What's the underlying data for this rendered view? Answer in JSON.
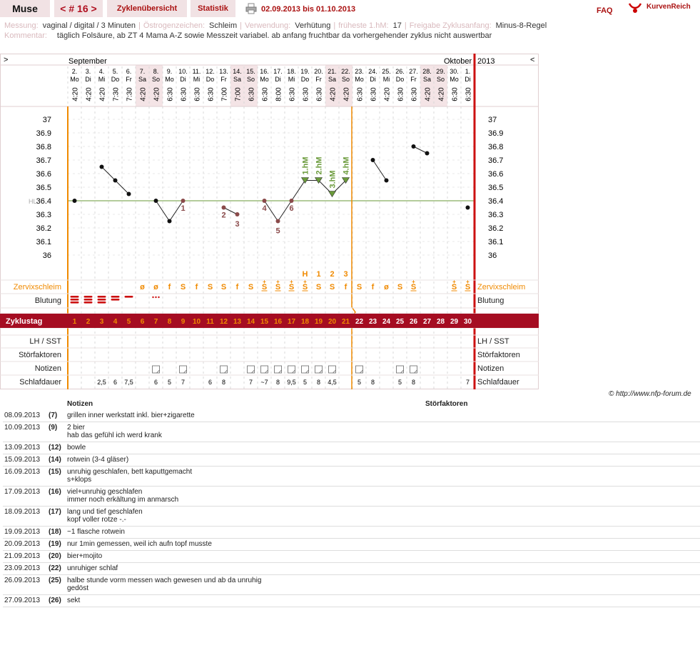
{
  "header": {
    "name": "Muse",
    "cycle_nav": "< # 16 >",
    "tab_overview": "Zyklenübersicht",
    "tab_stats": "Statistik",
    "date_range": "02.09.2013 bis 01.10.2013",
    "faq": "FAQ",
    "logo": "KurvenReich"
  },
  "info": {
    "measure_label": "Messung:",
    "measure": "vaginal / digital / 3 Minuten",
    "estrogen_label": "Östrogenzeichen:",
    "estrogen": "Schleim",
    "usage_label": "Verwendung:",
    "usage": "Verhütung",
    "earliest_label": "früheste 1.hM:",
    "earliest": "17",
    "release_label": "Freigabe Zyklusanfang:",
    "release": "Minus-8-Regel",
    "comment_label": "Kommentar:",
    "comment": "täglich Folsäure, ab ZT 4 Mama A-Z sowie Messzeit variabel. ab anfang fruchtbar da vorhergehender zyklus nicht auswertbar"
  },
  "months": {
    "left_arrow": ">",
    "sep": "September",
    "oct": "Oktober",
    "year": "2013",
    "right_arrow": "<"
  },
  "day_nums": [
    "2.",
    "3.",
    "4.",
    "5.",
    "6.",
    "7.",
    "8.",
    "9.",
    "10.",
    "11.",
    "12.",
    "13.",
    "14.",
    "15.",
    "16.",
    "17.",
    "18.",
    "19.",
    "20.",
    "21.",
    "22.",
    "23.",
    "24.",
    "25.",
    "26.",
    "27.",
    "28.",
    "29.",
    "30.",
    "1."
  ],
  "weekdays": [
    "Mo",
    "Di",
    "Mi",
    "Do",
    "Fr",
    "Sa",
    "So",
    "Mo",
    "Di",
    "Mi",
    "Do",
    "Fr",
    "Sa",
    "So",
    "Mo",
    "Di",
    "Mi",
    "Do",
    "Fr",
    "Sa",
    "So",
    "Mo",
    "Di",
    "Mi",
    "Do",
    "Fr",
    "Sa",
    "So",
    "Mo",
    "Di"
  ],
  "times": [
    "4:20",
    "4:20",
    "4:20",
    "7:30",
    "7:30",
    "4:20",
    "4:20",
    "6:30",
    "6:30",
    "6:30",
    "6:30",
    "7:00",
    "7:00",
    "6:30",
    "6:30",
    "8:00",
    "6:30",
    "6:30",
    "6:30",
    "4:20",
    "4:20",
    "6:30",
    "6:30",
    "4:20",
    "6:30",
    "6:30",
    "4:20",
    "4:20",
    "6:30",
    "6:30"
  ],
  "weekend": [
    5,
    6,
    12,
    13,
    19,
    20,
    26,
    27
  ],
  "chart_data": {
    "type": "line",
    "title": "",
    "ylabel": "",
    "ylim": [
      36.0,
      37.0
    ],
    "yticks": [
      "37",
      "36.9",
      "36.8",
      "36.7",
      "36.6",
      "36.5",
      "36.4",
      "36.3",
      "36.2",
      "36.1",
      "36"
    ],
    "hl_label": "HL",
    "hl_value": 36.4,
    "temps": [
      36.4,
      null,
      36.65,
      36.55,
      36.45,
      null,
      36.4,
      36.25,
      36.4,
      null,
      null,
      36.35,
      36.3,
      null,
      36.4,
      36.25,
      36.4,
      36.55,
      36.55,
      36.45,
      36.55,
      null,
      36.7,
      36.55,
      null,
      36.8,
      36.75,
      null,
      null,
      36.35
    ],
    "excluded": [
      8,
      11,
      12,
      14,
      15,
      16
    ],
    "segments": [
      [
        0,
        0
      ],
      [
        2,
        4
      ],
      [
        6,
        8
      ],
      [
        11,
        12
      ],
      [
        14,
        20
      ],
      [
        22,
        23
      ],
      [
        25,
        26
      ],
      [
        29,
        29
      ]
    ],
    "point_labels": [
      {
        "day": 8,
        "text": "1"
      },
      {
        "day": 11,
        "text": "2"
      },
      {
        "day": 12,
        "text": "3"
      },
      {
        "day": 14,
        "text": "4"
      },
      {
        "day": 15,
        "text": "5"
      },
      {
        "day": 16,
        "text": "6"
      }
    ],
    "hm_labels": [
      {
        "day": 17,
        "text": "1.hM"
      },
      {
        "day": 18,
        "text": "2.hM"
      },
      {
        "day": 19,
        "text": "3.hM"
      },
      {
        "day": 20,
        "text": "4.hM"
      }
    ],
    "hm_days": [
      17,
      18,
      19,
      20
    ]
  },
  "mucus_peak": [
    {
      "day": 17,
      "text": "H"
    },
    {
      "day": 18,
      "text": "1"
    },
    {
      "day": 19,
      "text": "2"
    },
    {
      "day": 20,
      "text": "3"
    }
  ],
  "rows": {
    "mucus": "Zervixschleim",
    "bleeding": "Blutung",
    "cycle_day": "Zyklustag",
    "lh": "LH / SST",
    "disturb": "Störfaktoren",
    "notes": "Notizen",
    "sleep": "Schlafdauer"
  },
  "mucus": [
    "",
    "",
    "",
    "",
    "",
    "ø",
    "ø",
    "f",
    "S",
    "f",
    "S",
    "S",
    "f",
    "S",
    "S+",
    "S+",
    "S+",
    "S+",
    "S",
    "S",
    "f",
    "S",
    "f",
    "ø",
    "S",
    "S+",
    "",
    "",
    "S+",
    "S+"
  ],
  "bleeding": [
    3,
    3,
    3,
    2,
    1,
    0,
    0,
    0,
    0,
    0,
    0,
    0,
    0,
    0,
    0,
    0,
    0,
    0,
    0,
    0,
    0,
    0,
    0,
    0,
    0,
    0,
    0,
    0,
    0,
    0
  ],
  "spotting_day": 6,
  "cycle_days": [
    "1",
    "2",
    "3",
    "4",
    "5",
    "6",
    "7",
    "8",
    "9",
    "10",
    "11",
    "12",
    "13",
    "14",
    "15",
    "16",
    "17",
    "18",
    "19",
    "20",
    "21",
    "22",
    "23",
    "24",
    "25",
    "26",
    "27",
    "28",
    "29",
    "30"
  ],
  "note_days": [
    6,
    8,
    11,
    13,
    14,
    15,
    16,
    17,
    18,
    19,
    21,
    24,
    25
  ],
  "sleep": [
    "",
    "",
    "2,5",
    "6",
    "7,5",
    "",
    "6",
    "5",
    "7",
    "",
    "6",
    "8",
    "",
    "7",
    "~7",
    "8",
    "9,5",
    "5",
    "8",
    "4,5",
    "",
    "5",
    "8",
    "",
    "5",
    "8",
    "",
    "",
    "",
    "7"
  ],
  "copyright": "© http://www.nfp-forum.de",
  "notes_table": {
    "col_notes": "Notizen",
    "col_disturb": "Störfaktoren",
    "entries": [
      {
        "date": "08.09.2013",
        "day": "(7)",
        "text": [
          "grillen inner werkstatt inkl. bier+zigarette"
        ]
      },
      {
        "date": "10.09.2013",
        "day": "(9)",
        "text": [
          "2 bier",
          "hab das gefühl ich werd krank"
        ]
      },
      {
        "date": "13.09.2013",
        "day": "(12)",
        "text": [
          "bowle"
        ]
      },
      {
        "date": "15.09.2013",
        "day": "(14)",
        "text": [
          "rotwein (3-4 gläser)"
        ]
      },
      {
        "date": "16.09.2013",
        "day": "(15)",
        "text": [
          "unruhig geschlafen, bett kaputtgemacht",
          "s+klops"
        ]
      },
      {
        "date": "17.09.2013",
        "day": "(16)",
        "text": [
          "viel+unruhig geschlafen",
          "immer noch erkältung im anmarsch"
        ]
      },
      {
        "date": "18.09.2013",
        "day": "(17)",
        "text": [
          "lang und tief geschlafen",
          "kopf voller rotze -.-"
        ]
      },
      {
        "date": "19.09.2013",
        "day": "(18)",
        "text": [
          "~1 flasche rotwein"
        ]
      },
      {
        "date": "20.09.2013",
        "day": "(19)",
        "text": [
          "nur 1min gemessen, weil ich aufn topf musste"
        ]
      },
      {
        "date": "21.09.2013",
        "day": "(20)",
        "text": [
          "bier+mojito"
        ]
      },
      {
        "date": "23.09.2013",
        "day": "(22)",
        "text": [
          "unruhiger schlaf"
        ]
      },
      {
        "date": "26.09.2013",
        "day": "(25)",
        "text": [
          "halbe stunde vorm messen wach gewesen und ab da unruhig",
          "gedöst"
        ]
      },
      {
        "date": "27.09.2013",
        "day": "(26)",
        "text": [
          "sekt"
        ]
      }
    ]
  },
  "colors": {
    "accent": "#a50d22",
    "orange": "#f08a00",
    "green": "#6a9a3a",
    "pink": "#f4e4e6",
    "brown": "#8a4a4a"
  }
}
